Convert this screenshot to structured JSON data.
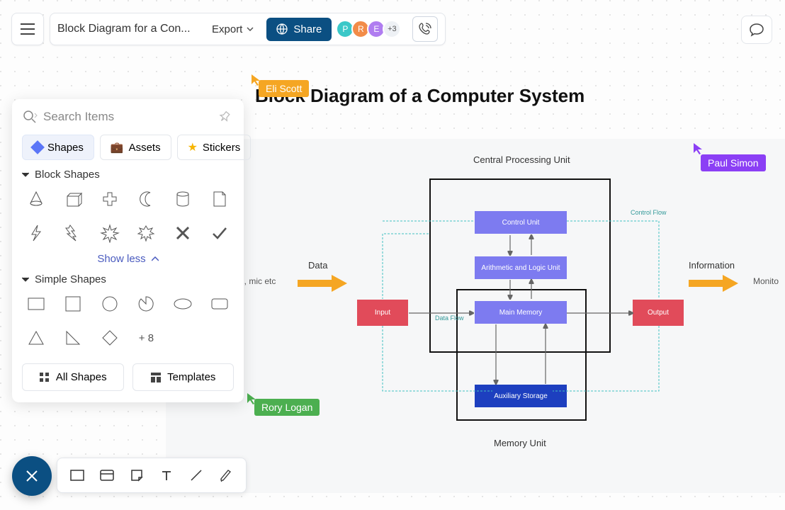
{
  "toolbar": {
    "doc_title": "Block Diagram for a Con...",
    "export_label": "Export",
    "share_label": "Share",
    "avatars": [
      {
        "initial": "P",
        "color": "#3bc8c8"
      },
      {
        "initial": "R",
        "color": "#f28c49"
      },
      {
        "initial": "E",
        "color": "#b07df0"
      }
    ],
    "more_count": "+3"
  },
  "panel": {
    "search_placeholder": "Search Items",
    "tabs": {
      "shapes": "Shapes",
      "assets": "Assets",
      "stickers": "Stickers"
    },
    "sections": {
      "block": "Block Shapes",
      "simple": "Simple Shapes"
    },
    "show_less": "Show less",
    "plus_more": "+ 8",
    "footer": {
      "all_shapes": "All Shapes",
      "templates": "Templates"
    }
  },
  "presence": {
    "eli": {
      "name": "Eli Scott",
      "color": "#f5a623"
    },
    "rory": {
      "name": "Rory Logan",
      "color": "#4caf50"
    },
    "paul": {
      "name": "Paul Simon",
      "color": "#8b3ff5"
    }
  },
  "diagram": {
    "title": "Block Diagram of a Computer System",
    "cpu_label": "Central Processing Unit",
    "memory_label": "Memory Unit",
    "blocks": {
      "control_unit": "Control Unit",
      "alu": "Arithmetic and Logic Unit",
      "main_memory": "Main Memory",
      "aux_storage": "Auxiliary Storage",
      "input": "Input",
      "output": "Output"
    },
    "labels": {
      "data": "Data",
      "keyboard": "rd, mic etc",
      "information": "Information",
      "monitor": "Monito",
      "control_flow": "Control Flow",
      "data_flow": "Data Flow"
    },
    "colors": {
      "input_output": "#e14b5a",
      "cpu_block": "#7d7bf0",
      "aux_block": "#1d3fbf",
      "control_line": "#42c2c2"
    }
  }
}
